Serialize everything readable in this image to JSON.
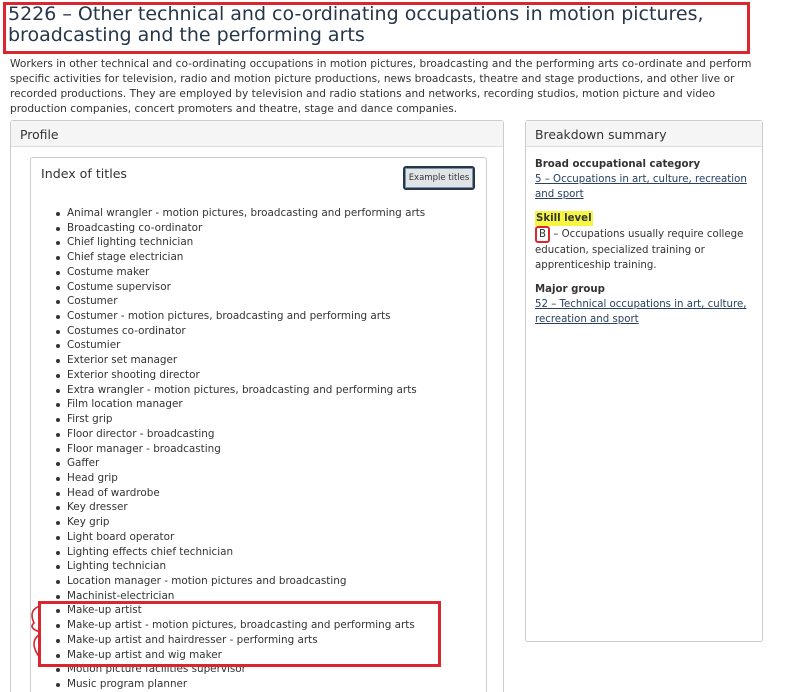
{
  "page": {
    "title": "5226 – Other technical and co-ordinating occupations in motion pictures, broadcasting and the performing arts",
    "intro": "Workers in other technical and co-ordinating occupations in motion pictures, broadcasting and the performing arts co-ordinate and perform specific activities for television, radio and motion picture productions, news broadcasts, theatre and stage productions, and other live or recorded productions. They are employed by television and radio stations and networks, recording studios, motion picture and video production companies, concert promoters and theatre, stage and dance companies."
  },
  "profile": {
    "heading": "Profile",
    "index": {
      "title": "Index of titles",
      "button_label": "Example titles",
      "titles": [
        "Animal wrangler - motion pictures, broadcasting and performing arts",
        "Broadcasting co-ordinator",
        "Chief lighting technician",
        "Chief stage electrician",
        "Costume maker",
        "Costume supervisor",
        "Costumer",
        "Costumer - motion pictures, broadcasting and performing arts",
        "Costumes co-ordinator",
        "Costumier",
        "Exterior set manager",
        "Exterior shooting director",
        "Extra wrangler - motion pictures, broadcasting and performing arts",
        "Film location manager",
        "First grip",
        "Floor director - broadcasting",
        "Floor manager - broadcasting",
        "Gaffer",
        "Head grip",
        "Head of wardrobe",
        "Key dresser",
        "Key grip",
        "Light board operator",
        "Lighting effects chief technician",
        "Lighting technician",
        "Location manager - motion pictures and broadcasting",
        "Machinist-electrician",
        "Make-up artist",
        "Make-up artist - motion pictures, broadcasting and performing arts",
        "Make-up artist and hairdresser - performing arts",
        "Make-up artist and wig maker",
        "Motion picture facilities supervisor",
        "Music program planner"
      ]
    }
  },
  "breakdown": {
    "heading": "Breakdown summary",
    "broad_category": {
      "label": "Broad occupational category",
      "link": "5 – Occupations in art, culture, recreation and sport"
    },
    "skill_level": {
      "label": "Skill level",
      "code": "B",
      "text": " – Occupations usually require college education, specialized training or apprenticeship training."
    },
    "major_group": {
      "label": "Major group",
      "link": "52 – Technical occupations in art, culture, recreation and sport"
    }
  },
  "colors": {
    "annotation_red": "#d9262f",
    "highlight_yellow": "#f5f542",
    "link": "#284162",
    "title": "#26374a"
  }
}
